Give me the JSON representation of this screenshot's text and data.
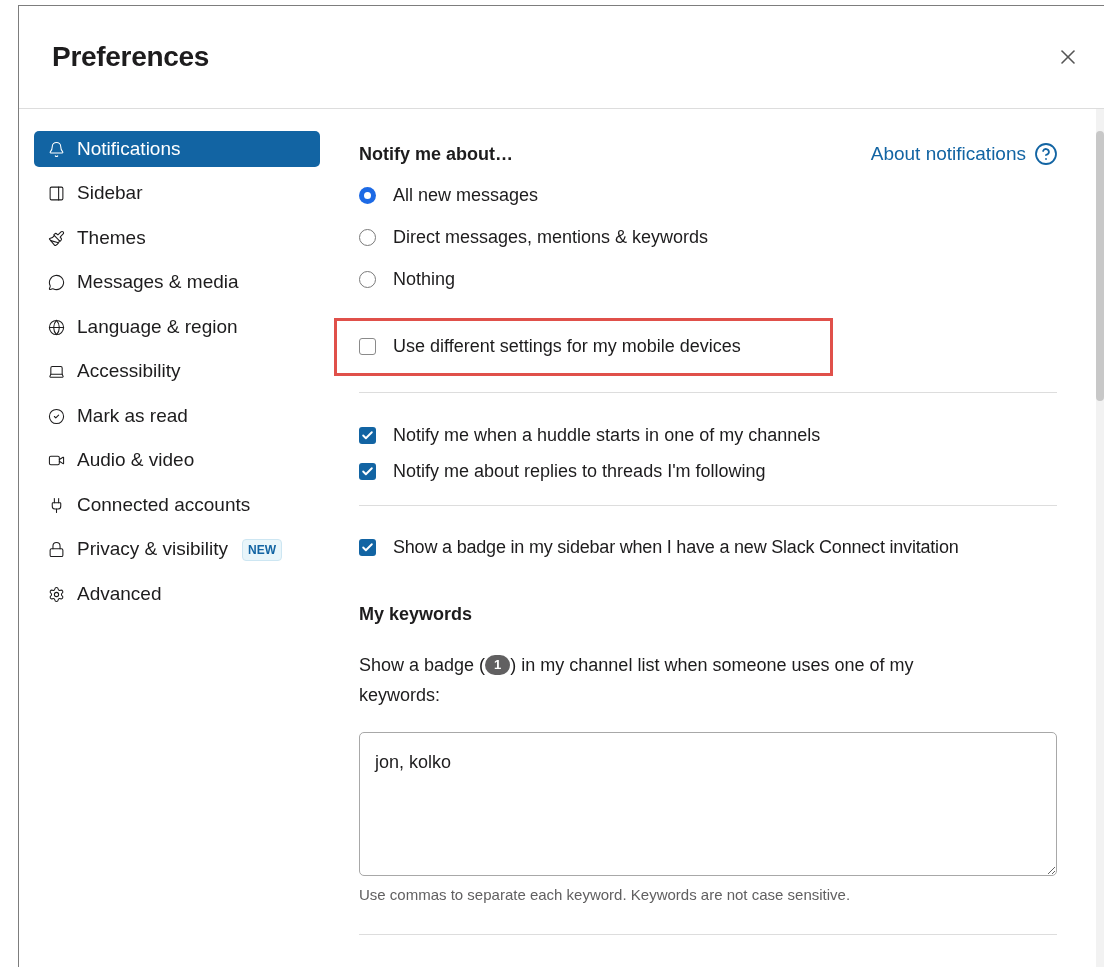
{
  "window": {
    "title": "Preferences"
  },
  "sidebar": {
    "items": [
      {
        "label": "Notifications",
        "selected": true
      },
      {
        "label": "Sidebar",
        "selected": false
      },
      {
        "label": "Themes",
        "selected": false
      },
      {
        "label": "Messages & media",
        "selected": false
      },
      {
        "label": "Language & region",
        "selected": false
      },
      {
        "label": "Accessibility",
        "selected": false
      },
      {
        "label": "Mark as read",
        "selected": false
      },
      {
        "label": "Audio & video",
        "selected": false
      },
      {
        "label": "Connected accounts",
        "selected": false
      },
      {
        "label": "Privacy & visibility",
        "selected": false,
        "badge": "NEW"
      },
      {
        "label": "Advanced",
        "selected": false
      }
    ]
  },
  "notify": {
    "heading": "Notify me about…",
    "help_link": "About notifications",
    "options": [
      {
        "label": "All new messages",
        "selected": true
      },
      {
        "label": "Direct messages, mentions & keywords",
        "selected": false
      },
      {
        "label": "Nothing",
        "selected": false
      }
    ]
  },
  "mobile_setting": {
    "label": "Use different settings for my mobile devices",
    "checked": false,
    "highlighted": true
  },
  "channel_checks": [
    {
      "label": "Notify me when a huddle starts in one of my channels",
      "checked": true
    },
    {
      "label": "Notify me about replies to threads I'm following",
      "checked": true
    }
  ],
  "invitation_check": {
    "label": "Show a badge in my sidebar when I have a new Slack Connect invitation",
    "checked": true
  },
  "keywords": {
    "heading": "My keywords",
    "description_start": "Show a badge (",
    "badge": "1",
    "description_end": ") in my channel list when someone uses one of my keywords:",
    "value": "jon, kolko",
    "hint": "Use commas to separate each keyword. Keywords are not case sensitive."
  }
}
